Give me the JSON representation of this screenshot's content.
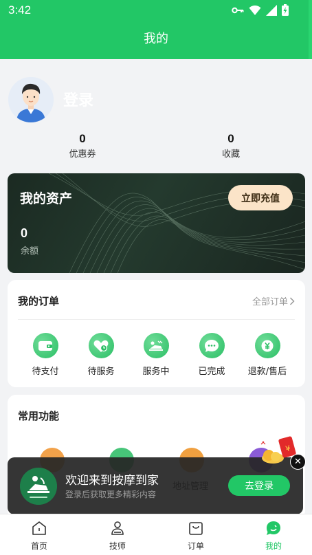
{
  "status_bar": {
    "time": "3:42"
  },
  "header": {
    "title": "我的"
  },
  "profile": {
    "login_label": "登录",
    "stats": [
      {
        "value": "0",
        "label": "优惠券"
      },
      {
        "value": "0",
        "label": "收藏"
      }
    ]
  },
  "assets": {
    "title": "我的资产",
    "recharge_label": "立即充值",
    "balance_value": "0",
    "balance_label": "余额"
  },
  "orders": {
    "title": "我的订单",
    "all_label": "全部订单",
    "items": [
      {
        "label": "待支付",
        "icon": "wallet-icon"
      },
      {
        "label": "待服务",
        "icon": "heart-clock-icon"
      },
      {
        "label": "服务中",
        "icon": "massage-bed-icon"
      },
      {
        "label": "已完成",
        "icon": "chat-dots-icon"
      },
      {
        "label": "退款/售后",
        "icon": "yuan-refund-icon"
      }
    ]
  },
  "functions": {
    "title": "常用功能",
    "items": [
      {
        "label": "",
        "icon": "orange-function-icon"
      },
      {
        "label": "",
        "icon": "green-heart-icon"
      },
      {
        "label": "地址管理",
        "icon": "location-icon"
      },
      {
        "label": "",
        "icon": "purple-chat-icon"
      }
    ]
  },
  "toast": {
    "title": "欢迎来到按摩到家",
    "subtitle": "登录后获取更多精彩内容",
    "button_label": "去登录"
  },
  "tabbar": {
    "items": [
      {
        "label": "首页",
        "icon": "home-icon",
        "active": false
      },
      {
        "label": "技师",
        "icon": "technician-icon",
        "active": false
      },
      {
        "label": "订单",
        "icon": "order-bag-icon",
        "active": false
      },
      {
        "label": "我的",
        "icon": "profile-bubble-icon",
        "active": true
      }
    ]
  },
  "colors": {
    "brand_green": "#22c766",
    "asset_card_bg": "#1f3127",
    "recharge_button": "#fbe4c8",
    "toast_bg": "#262626"
  }
}
